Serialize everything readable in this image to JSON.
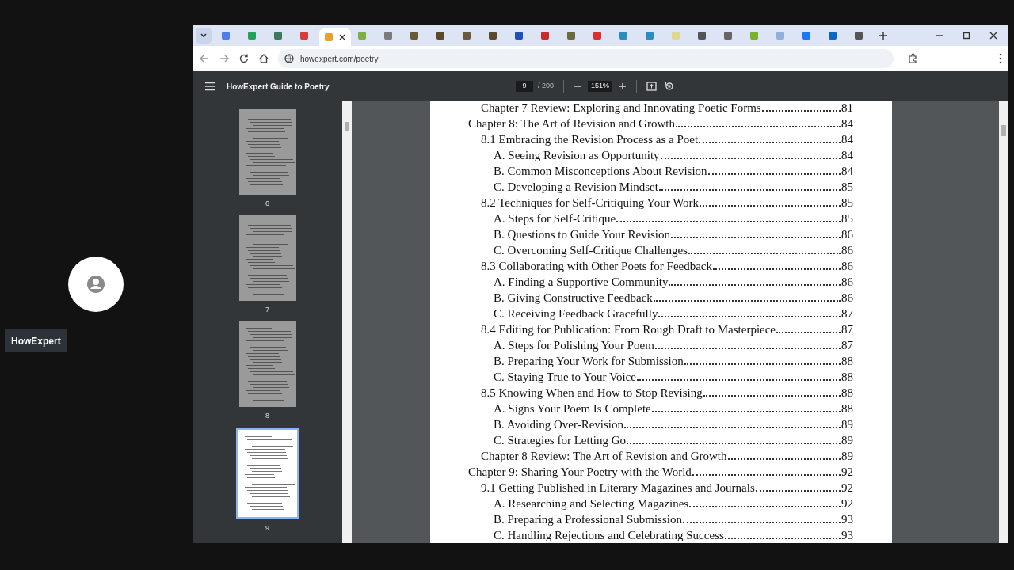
{
  "participant": {
    "name": "HowExpert"
  },
  "browser": {
    "tabs": [
      {
        "color": "#4a7ee8",
        "selected": false
      },
      {
        "color": "#22a35a",
        "selected": false
      },
      {
        "color": "#3d7a5c",
        "selected": false
      },
      {
        "color": "#d93a3a",
        "selected": false
      },
      {
        "color": "#e8a030",
        "selected": true
      },
      {
        "color": "#7bb043",
        "selected": false
      },
      {
        "color": "#7a7a7a",
        "selected": false
      },
      {
        "color": "#6b5a3a",
        "selected": false
      },
      {
        "color": "#5a4a2a",
        "selected": false
      },
      {
        "color": "#6b5a3a",
        "selected": false
      },
      {
        "color": "#5a4a2a",
        "selected": false
      },
      {
        "color": "#1f4fb8",
        "selected": false
      },
      {
        "color": "#cc2a2a",
        "selected": false
      },
      {
        "color": "#6b6a3a",
        "selected": false
      },
      {
        "color": "#d63030",
        "selected": false
      },
      {
        "color": "#2b8cbf",
        "selected": false
      },
      {
        "color": "#2b8cbf",
        "selected": false
      },
      {
        "color": "#e0d890",
        "selected": false
      },
      {
        "color": "#555555",
        "selected": false
      },
      {
        "color": "#666666",
        "selected": false
      },
      {
        "color": "#79b22a",
        "selected": false
      },
      {
        "color": "#8fb0d8",
        "selected": false
      },
      {
        "color": "#1877f2",
        "selected": false
      },
      {
        "color": "#0a66c2",
        "selected": false
      },
      {
        "color": "#555555",
        "selected": false
      }
    ],
    "url": "howexpert.com/poetry"
  },
  "viewer": {
    "title": "HowExpert Guide to Poetry",
    "page": "9",
    "page_total": "/ 200",
    "zoom": "151%",
    "thumbnails": [
      {
        "label": "6",
        "selected": false
      },
      {
        "label": "7",
        "selected": false
      },
      {
        "label": "8",
        "selected": false
      },
      {
        "label": "9",
        "selected": true
      }
    ],
    "toc": [
      {
        "children": [
          {
            "title": "Chapter 7 Review: Exploring and Innovating Poetic Forms",
            "page": "81"
          }
        ]
      },
      {
        "title": "Chapter 8: The Art of Revision and Growth",
        "page": "84",
        "children": [
          {
            "title": "8.1 Embracing the Revision Process as a Poet",
            "page": "84",
            "children": [
              {
                "title": "A. Seeing Revision as Opportunity",
                "page": "84"
              },
              {
                "title": "B. Common Misconceptions About Revision",
                "page": "84"
              },
              {
                "title": "C. Developing a Revision Mindset",
                "page": "85"
              }
            ]
          },
          {
            "title": "8.2 Techniques for Self-Critiquing Your Work",
            "page": "85",
            "children": [
              {
                "title": "A. Steps for Self-Critique",
                "page": "85"
              },
              {
                "title": "B. Questions to Guide Your Revision",
                "page": "86"
              },
              {
                "title": "C. Overcoming Self-Critique Challenges",
                "page": "86"
              }
            ]
          },
          {
            "title": "8.3 Collaborating with Other Poets for Feedback",
            "page": "86",
            "children": [
              {
                "title": "A. Finding a Supportive Community",
                "page": "86"
              },
              {
                "title": "B. Giving Constructive Feedback",
                "page": "86"
              },
              {
                "title": "C. Receiving Feedback Gracefully",
                "page": "87"
              }
            ]
          },
          {
            "title": "8.4 Editing for Publication: From Rough Draft to Masterpiece",
            "page": "87",
            "children": [
              {
                "title": "A. Steps for Polishing Your Poem",
                "page": "87"
              },
              {
                "title": "B. Preparing Your Work for Submission",
                "page": "88"
              },
              {
                "title": "C. Staying True to Your Voice",
                "page": "88"
              }
            ]
          },
          {
            "title": "8.5 Knowing When and How to Stop Revising",
            "page": "88",
            "children": [
              {
                "title": "A. Signs Your Poem Is Complete",
                "page": "88"
              },
              {
                "title": "B. Avoiding Over-Revision",
                "page": "89"
              },
              {
                "title": "C. Strategies for Letting Go",
                "page": "89"
              }
            ]
          },
          {
            "title": "Chapter 8 Review: The Art of Revision and Growth",
            "page": "89"
          }
        ]
      },
      {
        "title": "Chapter 9: Sharing Your Poetry with the World",
        "page": "92",
        "children": [
          {
            "title": "9.1 Getting Published in Literary Magazines and Journals",
            "page": "92",
            "children": [
              {
                "title": "A. Researching and Selecting Magazines",
                "page": "92"
              },
              {
                "title": "B. Preparing a Professional Submission",
                "page": "93"
              },
              {
                "title": "C. Handling Rejections and Celebrating Success",
                "page": "93"
              }
            ]
          }
        ]
      }
    ]
  }
}
